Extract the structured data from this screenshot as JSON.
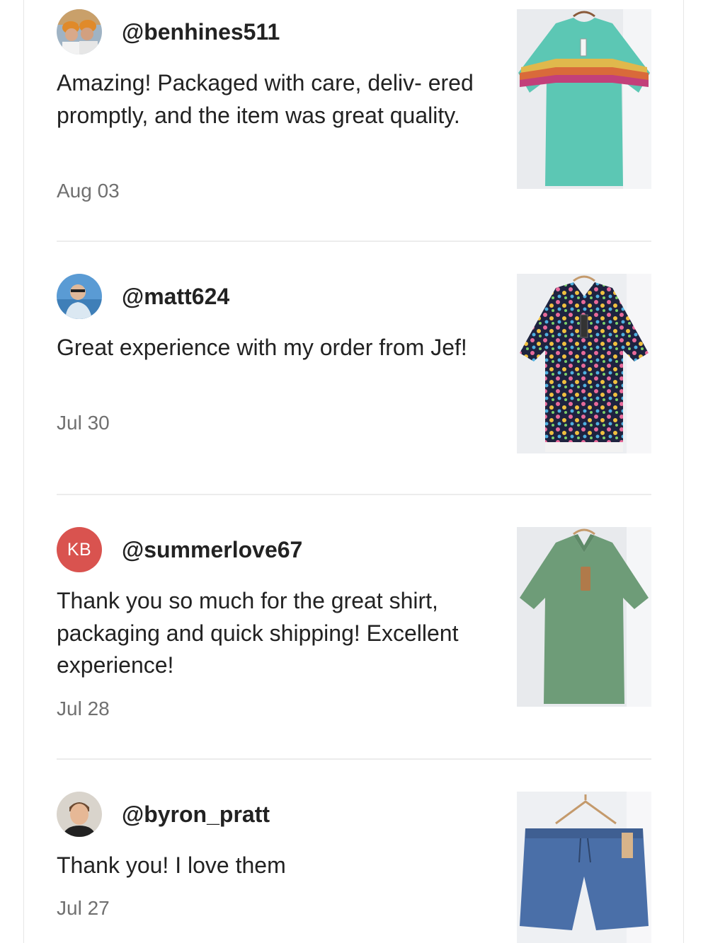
{
  "reviews": [
    {
      "username": "@benhines511",
      "text": "Amazing! Packaged with care, deliv- ered promptly, and the item was great quality.",
      "date": "Aug 03",
      "avatar_icon": "user-photo-avatar",
      "product_icon": "teal-striped-tshirt-photo"
    },
    {
      "username": "@matt624",
      "text": "Great experience with my order from Jef!",
      "date": "Jul 30",
      "avatar_icon": "user-photo-avatar",
      "product_icon": "floral-print-polo-photo"
    },
    {
      "username": "@summerlove67",
      "avatar_initials": "KB",
      "text": "Thank you so much for the great shirt, packaging and quick shipping! Excellent experience!",
      "date": "Jul 28",
      "avatar_icon": "initials-avatar",
      "product_icon": "green-polo-photo"
    },
    {
      "username": "@byron_pratt",
      "text": "Thank you! I love them",
      "date": "Jul 27",
      "avatar_icon": "user-photo-avatar",
      "product_icon": "blue-shorts-photo"
    }
  ],
  "colors": {
    "text": "#222222",
    "date": "#707070",
    "divider": "#ececec",
    "initials_avatar_bg": "#d9534f"
  }
}
